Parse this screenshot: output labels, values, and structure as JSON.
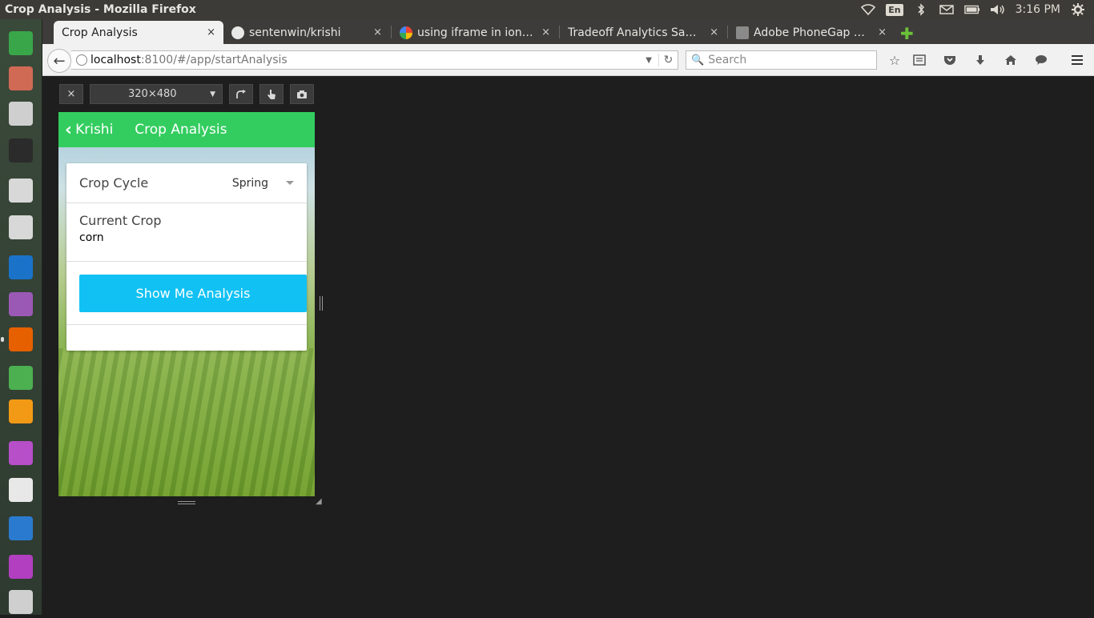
{
  "window": {
    "title": "Crop Analysis - Mozilla Firefox",
    "clock": "3:16 PM",
    "language": "En"
  },
  "tray_icons": [
    "wifi-icon",
    "bluetooth-icon",
    "mail-icon",
    "battery-icon",
    "volume-icon",
    "gear-icon"
  ],
  "launcher": [
    {
      "name": "ubuntu-home-icon",
      "color": "#3aa64a"
    },
    {
      "name": "file-manager-icon",
      "color": "#d06a55"
    },
    {
      "name": "system-settings-icon",
      "color": "#cfcfcf"
    },
    {
      "name": "terminal-icon",
      "color": "#2b2b2b"
    },
    {
      "name": "disk-drive-icon",
      "color": "#d8d8d8"
    },
    {
      "name": "disk-drive-icon-2",
      "color": "#d8d8d8"
    },
    {
      "name": "teamviewer-icon",
      "color": "#1a73c8"
    },
    {
      "name": "video-player-icon",
      "color": "#9b59b6"
    },
    {
      "name": "firefox-icon",
      "color": "#e66000"
    },
    {
      "name": "chrome-icon",
      "color": "#4caf50"
    },
    {
      "name": "sublime-text-icon",
      "color": "#f29a16"
    },
    {
      "name": "remote-desktop-icon",
      "color": "#b64fc8"
    },
    {
      "name": "text-editor-icon",
      "color": "#e8e8e8"
    },
    {
      "name": "libreoffice-writer-icon",
      "color": "#2a7bd0"
    },
    {
      "name": "workspace-switcher-icon",
      "color": "#b13fbf"
    },
    {
      "name": "trash-icon",
      "color": "#cfcfcf"
    }
  ],
  "tabs": [
    {
      "label": "Crop Analysis",
      "favicon": null,
      "active": true
    },
    {
      "label": "sentenwin/krishi",
      "favicon": "github-icon",
      "active": false
    },
    {
      "label": "using iframe in ionic ...",
      "favicon": "google-icon",
      "active": false
    },
    {
      "label": "Tradeoff Analytics Sam...",
      "favicon": null,
      "active": false
    },
    {
      "label": "Adobe PhoneGap B...",
      "favicon": "phonegap-icon",
      "active": false
    }
  ],
  "tab_close_glyph": "×",
  "nav": {
    "url_host": "localhost",
    "url_path": ":8100/#/app/startAnalysis",
    "search_placeholder": "Search"
  },
  "rdm": {
    "close": "×",
    "size": "320×480"
  },
  "app": {
    "back_label": "Krishi",
    "title": "Crop Analysis",
    "crop_cycle_label": "Crop Cycle",
    "crop_cycle_value": "Spring",
    "current_crop_label": "Current Crop",
    "current_crop_value": "corn",
    "button_label": "Show Me Analysis",
    "header_color": "#33cd5f",
    "button_color": "#11c1f3"
  }
}
